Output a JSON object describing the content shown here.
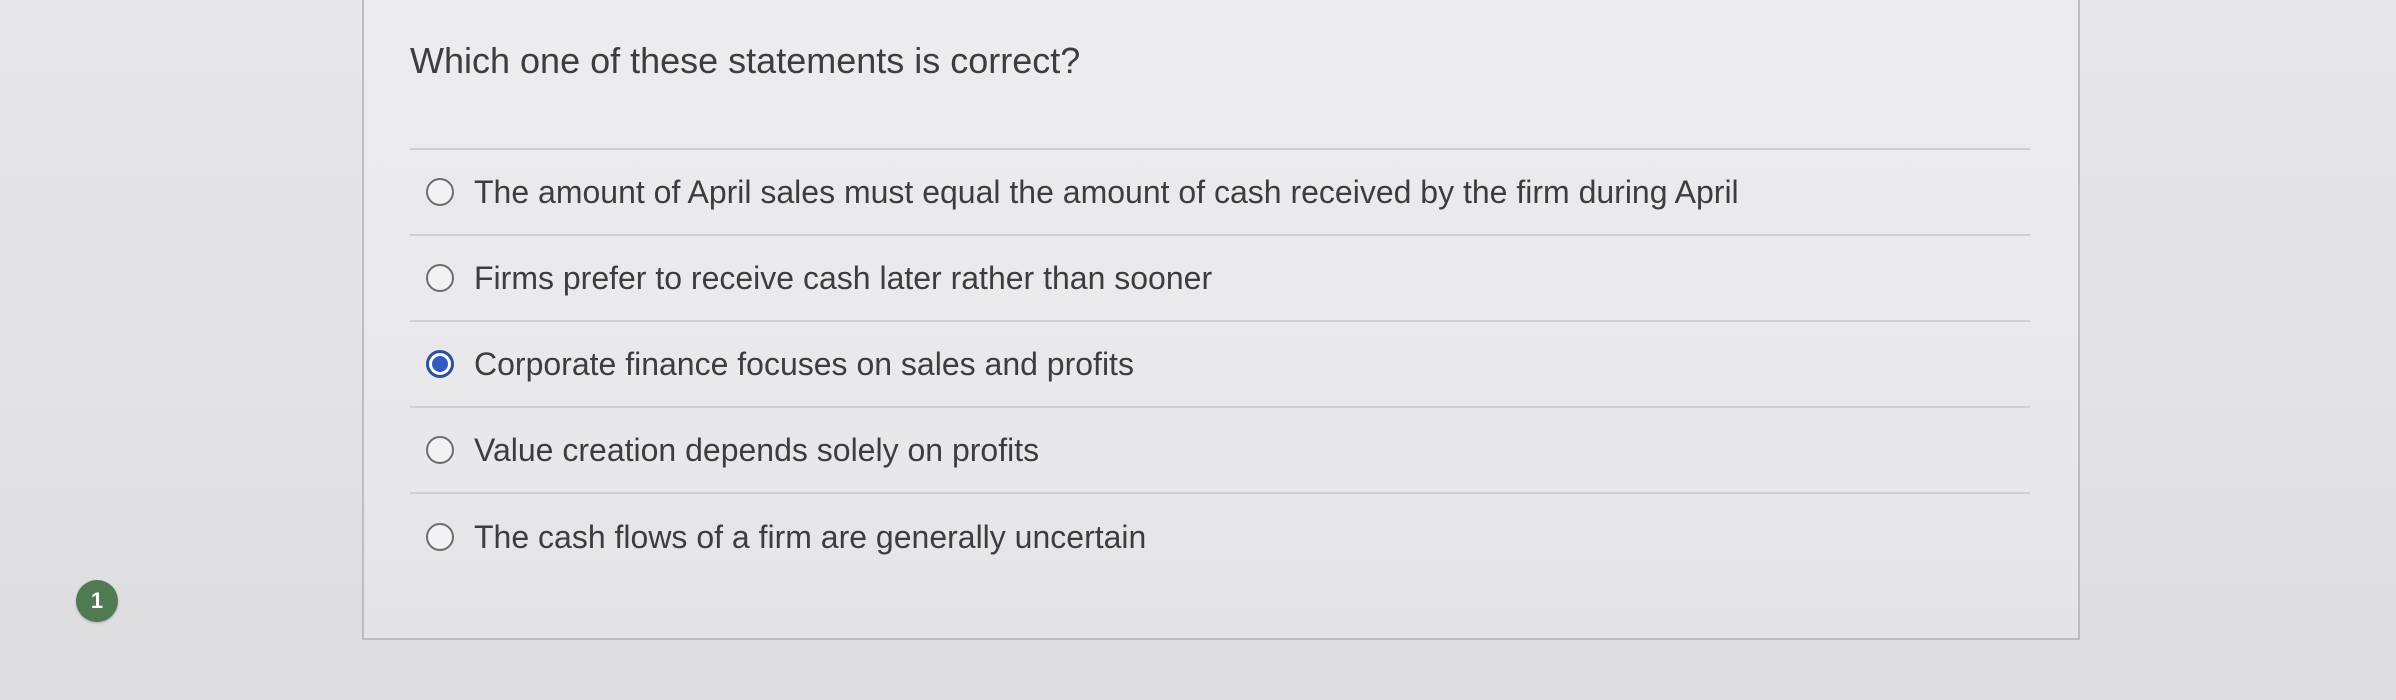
{
  "badge": {
    "number": "1"
  },
  "question": {
    "text": "Which one of these statements is correct?"
  },
  "options": [
    {
      "label": "The amount of April sales must equal the amount of cash received by the firm during April",
      "selected": false
    },
    {
      "label": "Firms prefer to receive cash later rather than sooner",
      "selected": false
    },
    {
      "label": "Corporate finance focuses on sales and profits",
      "selected": true
    },
    {
      "label": "Value creation depends solely on profits",
      "selected": false
    },
    {
      "label": "The cash flows of a firm are generally uncertain",
      "selected": false
    }
  ],
  "colors": {
    "selected_radio": "#2f5dc4",
    "badge": "#4f7a52"
  },
  "icons": {
    "radio_unselected": "radio-unselected-icon",
    "radio_selected": "radio-selected-icon"
  }
}
